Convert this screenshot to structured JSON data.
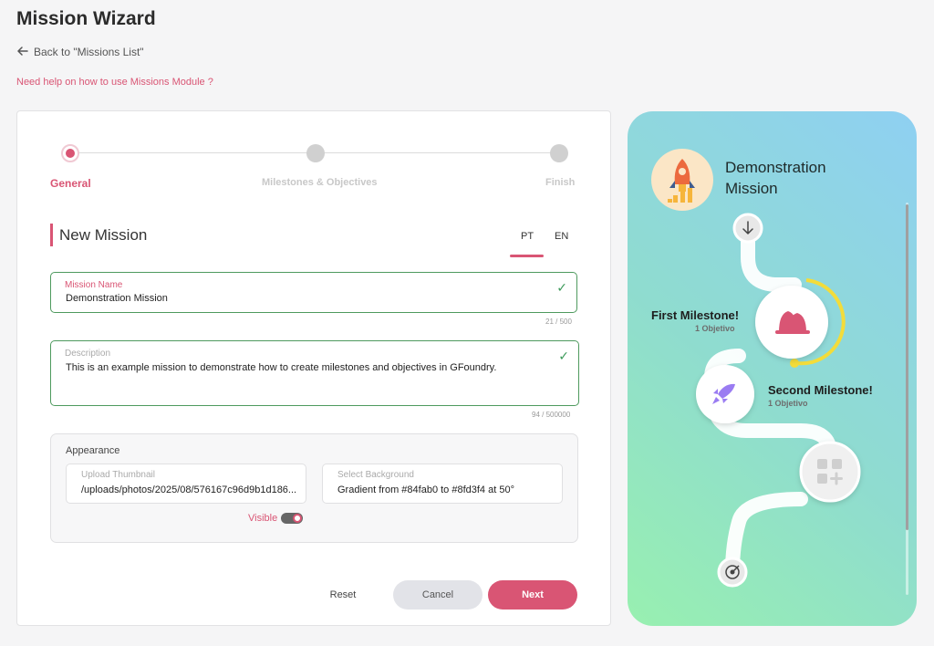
{
  "header": {
    "title": "Mission Wizard",
    "back_label": "Back to \"Missions List\"",
    "help_label": "Need help on how to use Missions Module ?"
  },
  "stepper": {
    "steps": [
      {
        "label": "General",
        "state": "active"
      },
      {
        "label": "Milestones & Objectives",
        "state": "pending"
      },
      {
        "label": "Finish",
        "state": "pending"
      }
    ]
  },
  "section": {
    "title": "New Mission",
    "languages": [
      "PT",
      "EN"
    ],
    "selected_language": "PT"
  },
  "form": {
    "mission_name": {
      "label": "Mission Name",
      "value": "Demonstration Mission",
      "counter": "21 / 500"
    },
    "description": {
      "label": "Description",
      "value": "This is an example mission to demonstrate how to create milestones and objectives in GFoundry.",
      "counter": "94 / 500000"
    }
  },
  "appearance": {
    "title": "Appearance",
    "thumbnail": {
      "label": "Upload Thumbnail",
      "value": "/uploads/photos/2025/08/576167c96d9b1d186..."
    },
    "background": {
      "label": "Select Background",
      "value": "Gradient from #84fab0 to #8fd3f4 at 50°"
    },
    "visible_label": "Visible",
    "visible": true
  },
  "actions": {
    "reset": "Reset",
    "cancel": "Cancel",
    "next": "Next"
  },
  "preview": {
    "title": "Demonstration Mission",
    "milestones": [
      {
        "name": "First Milestone!",
        "subtitle": "1 Objetivo",
        "icon": "bell-icon"
      },
      {
        "name": "Second Milestone!",
        "subtitle": "1 Objetivo",
        "icon": "rocket-icon"
      }
    ],
    "add_icon": "add-milestone-icon"
  },
  "colors": {
    "accent": "#d95574",
    "success": "#3c9a5a",
    "gradient_start": "#84fab0",
    "gradient_end": "#8fd3f4"
  }
}
